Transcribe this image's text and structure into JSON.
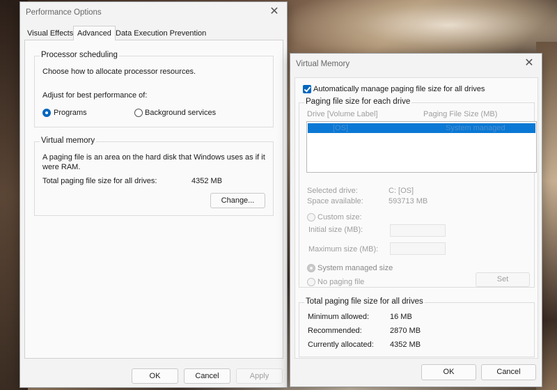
{
  "performance_options": {
    "title": "Performance Options",
    "tabs": [
      "Visual Effects",
      "Advanced",
      "Data Execution Prevention"
    ],
    "processor_scheduling": {
      "title": "Processor scheduling",
      "description": "Choose how to allocate processor resources.",
      "adjust_label": "Adjust for best performance of:",
      "options": [
        "Programs",
        "Background services"
      ],
      "selected": "Programs"
    },
    "virtual_memory": {
      "title": "Virtual memory",
      "description_line1": "A paging file is an area on the hard disk that Windows uses as if it",
      "description_line2": "were RAM.",
      "total_label": "Total paging file size for all drives:",
      "total_value": "4352 MB",
      "change_button": "Change..."
    },
    "buttons": {
      "ok": "OK",
      "cancel": "Cancel",
      "apply": "Apply"
    }
  },
  "virtual_memory_dialog": {
    "title": "Virtual Memory",
    "auto_manage_label": "Automatically manage paging file size for all drives",
    "auto_manage_checked": true,
    "paging_group": {
      "title": "Paging file size for each drive",
      "col_drive": "Drive  [Volume Label]",
      "col_size": "Paging File Size (MB)",
      "rows": [
        {
          "drive": "[OS]",
          "size": "System managed"
        }
      ],
      "selected_drive_label": "Selected drive:",
      "selected_drive_value": "C:  [OS]",
      "space_available_label": "Space available:",
      "space_available_value": "593713 MB",
      "custom_size_label": "Custom size:",
      "initial_size_label": "Initial size (MB):",
      "maximum_size_label": "Maximum size (MB):",
      "system_managed_label": "System managed size",
      "no_paging_label": "No paging file",
      "set_button": "Set"
    },
    "total_group": {
      "title": "Total paging file size for all drives",
      "minimum_label": "Minimum allowed:",
      "minimum_value": "16 MB",
      "recommended_label": "Recommended:",
      "recommended_value": "2870 MB",
      "current_label": "Currently allocated:",
      "current_value": "4352 MB"
    },
    "buttons": {
      "ok": "OK",
      "cancel": "Cancel"
    }
  },
  "colors": {
    "accent": "#0067c0",
    "selection": "#0a78d4"
  }
}
